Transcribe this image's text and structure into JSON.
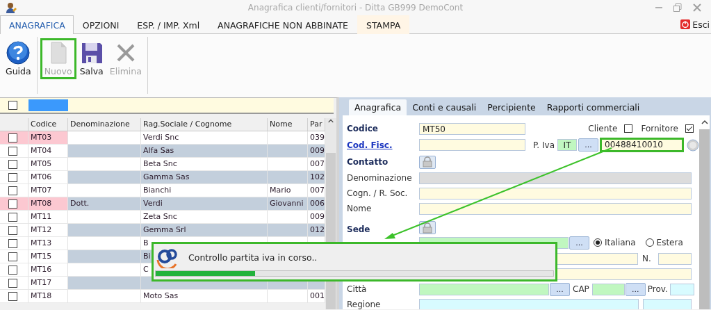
{
  "window": {
    "title": "Anagrafica clienti/fornitori - Ditta GB999 DemoCont"
  },
  "ribbon": {
    "tabs": [
      {
        "label": "ANAGRAFICA",
        "selected": true,
        "kind": "normal"
      },
      {
        "label": "OPZIONI",
        "selected": false,
        "kind": "normal"
      },
      {
        "label": "ESP. / IMP. Xml",
        "selected": false,
        "kind": "normal"
      },
      {
        "label": "ANAGRAFICHE NON ABBINATE",
        "selected": false,
        "kind": "normal"
      },
      {
        "label": "STAMPA",
        "selected": false,
        "kind": "contextual"
      }
    ],
    "exit": "Esci"
  },
  "toolbar": [
    {
      "label": "Guida",
      "kind": "help",
      "disabled": false,
      "highlighted": false
    },
    {
      "label": "Nuovo",
      "kind": "new",
      "disabled": true,
      "highlighted": true
    },
    {
      "label": "Salva",
      "kind": "save",
      "disabled": false,
      "highlighted": false
    },
    {
      "label": "Elimina",
      "kind": "delete",
      "disabled": true,
      "highlighted": false
    }
  ],
  "grid": {
    "filter_checked": false,
    "columns": [
      "Codice",
      "Denominazione",
      "Rag.Sociale / Cognome",
      "Nome",
      "Par"
    ],
    "rows": [
      {
        "codice": "MT03",
        "rag": "Verdi Snc",
        "par": "039",
        "checked": false,
        "flagged": true
      },
      {
        "codice": "MT04",
        "rag": "Alfa Sas",
        "par": "009",
        "checked": false,
        "flagged": false
      },
      {
        "codice": "MT05",
        "rag": "Beta Snc",
        "par": "007",
        "checked": false,
        "flagged": false
      },
      {
        "codice": "MT06",
        "rag": "Gamma Sas",
        "par": "102",
        "checked": false,
        "flagged": false
      },
      {
        "codice": "MT07",
        "rag": "Bianchi",
        "nome": "Mario",
        "par": "007",
        "checked": false,
        "flagged": false
      },
      {
        "codice": "MT08",
        "denominazione": "Dott.",
        "rag": "Verdi",
        "nome": "Giovanni",
        "par": "006",
        "checked": false,
        "flagged": true
      },
      {
        "codice": "MT11",
        "rag": "Zeta Snc",
        "par": "009",
        "checked": false,
        "flagged": false
      },
      {
        "codice": "MT12",
        "rag": "Gemma Srl",
        "par": "012",
        "checked": false,
        "flagged": false
      },
      {
        "codice": "MT13",
        "rag": "B",
        "checked": false,
        "flagged": false
      },
      {
        "codice": "MT15",
        "rag": "Bi",
        "checked": false,
        "flagged": false
      },
      {
        "codice": "MT16",
        "rag": "C",
        "checked": false,
        "flagged": false
      },
      {
        "codice": "MT17",
        "checked": false,
        "flagged": false
      },
      {
        "codice": "MT18",
        "rag": "Moto Sas",
        "par": "001",
        "checked": false,
        "flagged": false
      }
    ]
  },
  "form": {
    "tabs": [
      {
        "label": "Anagrafica",
        "selected": true
      },
      {
        "label": "Conti e causali",
        "selected": false
      },
      {
        "label": "Percipiente",
        "selected": false
      },
      {
        "label": "Rapporti commerciali",
        "selected": false
      }
    ],
    "codice": {
      "label": "Codice",
      "value": "MT50"
    },
    "cliente": {
      "label": "Cliente",
      "checked": false
    },
    "fornitore": {
      "label": "Fornitore",
      "checked": true
    },
    "cod_fisc": "Cod. Fisc.",
    "piva": {
      "label": "P. Iva",
      "country": "IT",
      "button": "...",
      "value": "00488410010",
      "highlighted": true
    },
    "contatto": "Contatto",
    "denominazione": "Denominazione",
    "cognome": "Cogn. / R. Soc.",
    "nome": "Nome",
    "sede": "Sede",
    "tipologia": {
      "button": "...",
      "options": [
        {
          "label": "Italiana",
          "selected": true
        },
        {
          "label": "Estera",
          "selected": false
        }
      ]
    },
    "numero": "N.",
    "citta": {
      "label": "Città",
      "button": "...",
      "cap": "CAP",
      "cap_button": "...",
      "prov": "Prov."
    },
    "regione": "Regione"
  },
  "dialog": {
    "message": "Controllo partita iva in corso..",
    "level": 0.25
  }
}
